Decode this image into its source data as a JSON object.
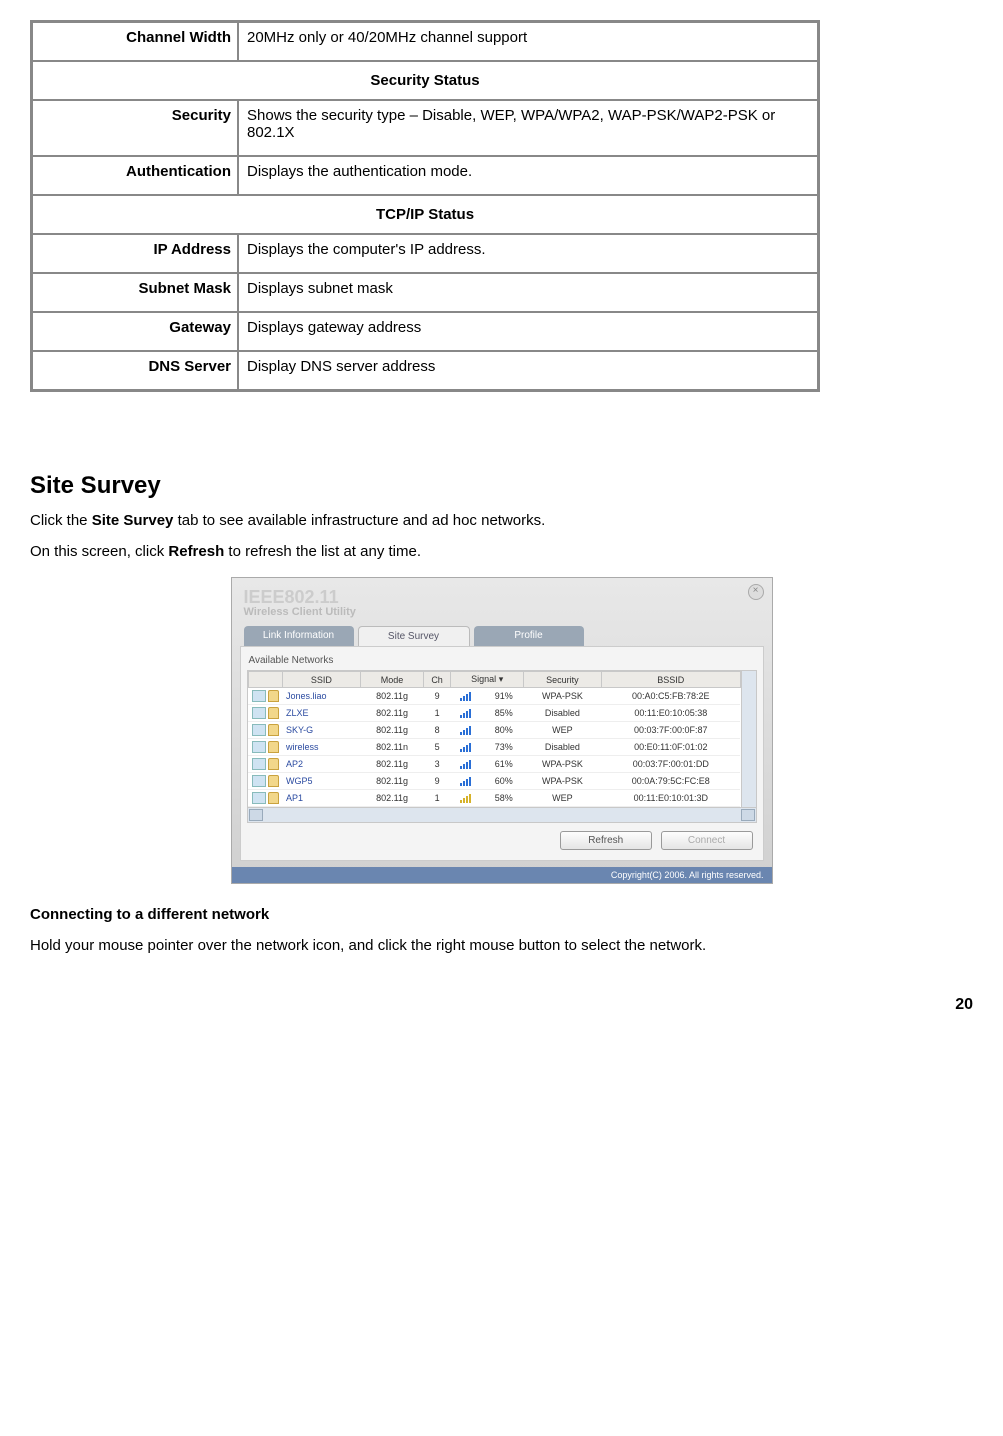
{
  "table": {
    "rows": [
      {
        "label": "Channel Width",
        "value": "20MHz only or 40/20MHz channel support"
      }
    ],
    "section_security": "Security Status",
    "sec_rows": [
      {
        "label": "Security",
        "value": "Shows the security type – Disable, WEP, WPA/WPA2, WAP-PSK/WAP2-PSK or 802.1X"
      },
      {
        "label": "Authentication",
        "value": "Displays the authentication mode."
      }
    ],
    "section_tcpip": "TCP/IP Status",
    "tcp_rows": [
      {
        "label": "IP Address",
        "value": "Displays the computer's IP address."
      },
      {
        "label": "Subnet Mask",
        "value": "Displays subnet mask"
      },
      {
        "label": "Gateway",
        "value": "Displays gateway address"
      },
      {
        "label": "DNS Server",
        "value": "Display DNS server address"
      }
    ]
  },
  "heading": "Site Survey",
  "para1_a": "Click the ",
  "para1_b": "Site Survey",
  "para1_c": " tab to see available infrastructure and ad hoc networks.",
  "para2_a": "On this screen, click ",
  "para2_b": "Refresh",
  "para2_c": " to refresh the list at any time.",
  "app": {
    "title_big": "IEEE802.11",
    "title_sub": "Wireless Client Utility",
    "tabs": {
      "link": "Link Information",
      "survey": "Site Survey",
      "profile": "Profile"
    },
    "fieldset": "Available Networks",
    "headers": {
      "ssid": "SSID",
      "mode": "Mode",
      "ch": "Ch",
      "signal": "Signal",
      "sigicon": "▾",
      "security": "Security",
      "bssid": "BSSID"
    },
    "rows": [
      {
        "ssid": "Jones.liao",
        "mode": "802.11g",
        "ch": "9",
        "signal": "91%",
        "security": "WPA-PSK",
        "bssid": "00:A0:C5:FB:78:2E",
        "weak": false
      },
      {
        "ssid": "ZLXE",
        "mode": "802.11g",
        "ch": "1",
        "signal": "85%",
        "security": "Disabled",
        "bssid": "00:11:E0:10:05:38",
        "weak": false
      },
      {
        "ssid": "SKY-G",
        "mode": "802.11g",
        "ch": "8",
        "signal": "80%",
        "security": "WEP",
        "bssid": "00:03:7F:00:0F:87",
        "weak": false
      },
      {
        "ssid": "wireless",
        "mode": "802.11n",
        "ch": "5",
        "signal": "73%",
        "security": "Disabled",
        "bssid": "00:E0:11:0F:01:02",
        "weak": false
      },
      {
        "ssid": "AP2",
        "mode": "802.11g",
        "ch": "3",
        "signal": "61%",
        "security": "WPA-PSK",
        "bssid": "00:03:7F:00:01:DD",
        "weak": false
      },
      {
        "ssid": "WGP5",
        "mode": "802.11g",
        "ch": "9",
        "signal": "60%",
        "security": "WPA-PSK",
        "bssid": "00:0A:79:5C:FC:E8",
        "weak": false
      },
      {
        "ssid": "AP1",
        "mode": "802.11g",
        "ch": "1",
        "signal": "58%",
        "security": "WEP",
        "bssid": "00:11:E0:10:01:3D",
        "weak": true
      }
    ],
    "buttons": {
      "refresh": "Refresh",
      "connect": "Connect"
    },
    "footer": "Copyright(C) 2006. All rights reserved."
  },
  "subhead": "Connecting to a different network",
  "para3": "Hold your mouse pointer over the network icon, and click the right mouse button to select the network.",
  "pagenum": "20"
}
